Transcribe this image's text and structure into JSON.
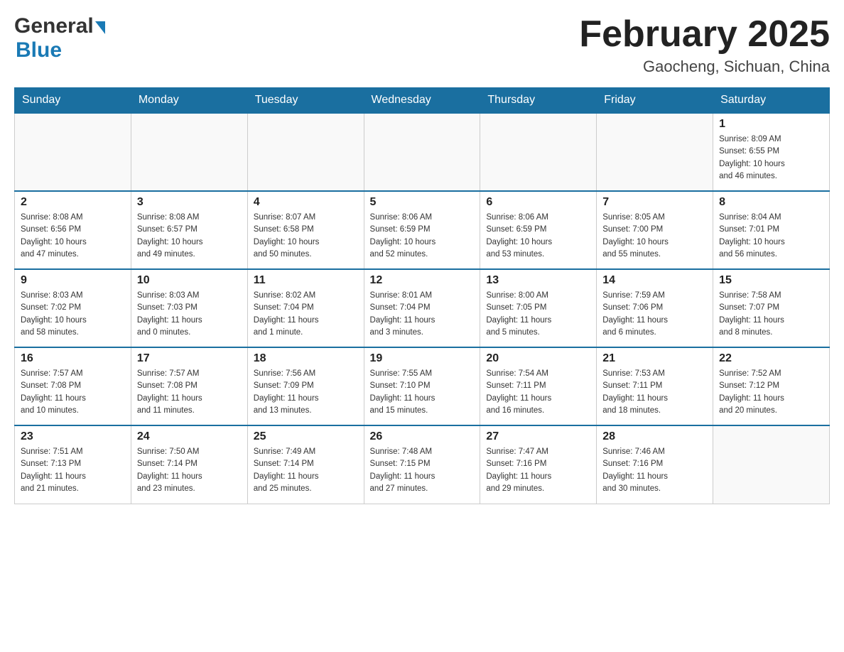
{
  "header": {
    "logo_general": "General",
    "logo_blue": "Blue",
    "month_title": "February 2025",
    "location": "Gaocheng, Sichuan, China"
  },
  "days_of_week": [
    "Sunday",
    "Monday",
    "Tuesday",
    "Wednesday",
    "Thursday",
    "Friday",
    "Saturday"
  ],
  "weeks": [
    {
      "days": [
        {
          "num": "",
          "info": ""
        },
        {
          "num": "",
          "info": ""
        },
        {
          "num": "",
          "info": ""
        },
        {
          "num": "",
          "info": ""
        },
        {
          "num": "",
          "info": ""
        },
        {
          "num": "",
          "info": ""
        },
        {
          "num": "1",
          "info": "Sunrise: 8:09 AM\nSunset: 6:55 PM\nDaylight: 10 hours\nand 46 minutes."
        }
      ]
    },
    {
      "days": [
        {
          "num": "2",
          "info": "Sunrise: 8:08 AM\nSunset: 6:56 PM\nDaylight: 10 hours\nand 47 minutes."
        },
        {
          "num": "3",
          "info": "Sunrise: 8:08 AM\nSunset: 6:57 PM\nDaylight: 10 hours\nand 49 minutes."
        },
        {
          "num": "4",
          "info": "Sunrise: 8:07 AM\nSunset: 6:58 PM\nDaylight: 10 hours\nand 50 minutes."
        },
        {
          "num": "5",
          "info": "Sunrise: 8:06 AM\nSunset: 6:59 PM\nDaylight: 10 hours\nand 52 minutes."
        },
        {
          "num": "6",
          "info": "Sunrise: 8:06 AM\nSunset: 6:59 PM\nDaylight: 10 hours\nand 53 minutes."
        },
        {
          "num": "7",
          "info": "Sunrise: 8:05 AM\nSunset: 7:00 PM\nDaylight: 10 hours\nand 55 minutes."
        },
        {
          "num": "8",
          "info": "Sunrise: 8:04 AM\nSunset: 7:01 PM\nDaylight: 10 hours\nand 56 minutes."
        }
      ]
    },
    {
      "days": [
        {
          "num": "9",
          "info": "Sunrise: 8:03 AM\nSunset: 7:02 PM\nDaylight: 10 hours\nand 58 minutes."
        },
        {
          "num": "10",
          "info": "Sunrise: 8:03 AM\nSunset: 7:03 PM\nDaylight: 11 hours\nand 0 minutes."
        },
        {
          "num": "11",
          "info": "Sunrise: 8:02 AM\nSunset: 7:04 PM\nDaylight: 11 hours\nand 1 minute."
        },
        {
          "num": "12",
          "info": "Sunrise: 8:01 AM\nSunset: 7:04 PM\nDaylight: 11 hours\nand 3 minutes."
        },
        {
          "num": "13",
          "info": "Sunrise: 8:00 AM\nSunset: 7:05 PM\nDaylight: 11 hours\nand 5 minutes."
        },
        {
          "num": "14",
          "info": "Sunrise: 7:59 AM\nSunset: 7:06 PM\nDaylight: 11 hours\nand 6 minutes."
        },
        {
          "num": "15",
          "info": "Sunrise: 7:58 AM\nSunset: 7:07 PM\nDaylight: 11 hours\nand 8 minutes."
        }
      ]
    },
    {
      "days": [
        {
          "num": "16",
          "info": "Sunrise: 7:57 AM\nSunset: 7:08 PM\nDaylight: 11 hours\nand 10 minutes."
        },
        {
          "num": "17",
          "info": "Sunrise: 7:57 AM\nSunset: 7:08 PM\nDaylight: 11 hours\nand 11 minutes."
        },
        {
          "num": "18",
          "info": "Sunrise: 7:56 AM\nSunset: 7:09 PM\nDaylight: 11 hours\nand 13 minutes."
        },
        {
          "num": "19",
          "info": "Sunrise: 7:55 AM\nSunset: 7:10 PM\nDaylight: 11 hours\nand 15 minutes."
        },
        {
          "num": "20",
          "info": "Sunrise: 7:54 AM\nSunset: 7:11 PM\nDaylight: 11 hours\nand 16 minutes."
        },
        {
          "num": "21",
          "info": "Sunrise: 7:53 AM\nSunset: 7:11 PM\nDaylight: 11 hours\nand 18 minutes."
        },
        {
          "num": "22",
          "info": "Sunrise: 7:52 AM\nSunset: 7:12 PM\nDaylight: 11 hours\nand 20 minutes."
        }
      ]
    },
    {
      "days": [
        {
          "num": "23",
          "info": "Sunrise: 7:51 AM\nSunset: 7:13 PM\nDaylight: 11 hours\nand 21 minutes."
        },
        {
          "num": "24",
          "info": "Sunrise: 7:50 AM\nSunset: 7:14 PM\nDaylight: 11 hours\nand 23 minutes."
        },
        {
          "num": "25",
          "info": "Sunrise: 7:49 AM\nSunset: 7:14 PM\nDaylight: 11 hours\nand 25 minutes."
        },
        {
          "num": "26",
          "info": "Sunrise: 7:48 AM\nSunset: 7:15 PM\nDaylight: 11 hours\nand 27 minutes."
        },
        {
          "num": "27",
          "info": "Sunrise: 7:47 AM\nSunset: 7:16 PM\nDaylight: 11 hours\nand 29 minutes."
        },
        {
          "num": "28",
          "info": "Sunrise: 7:46 AM\nSunset: 7:16 PM\nDaylight: 11 hours\nand 30 minutes."
        },
        {
          "num": "",
          "info": ""
        }
      ]
    }
  ]
}
